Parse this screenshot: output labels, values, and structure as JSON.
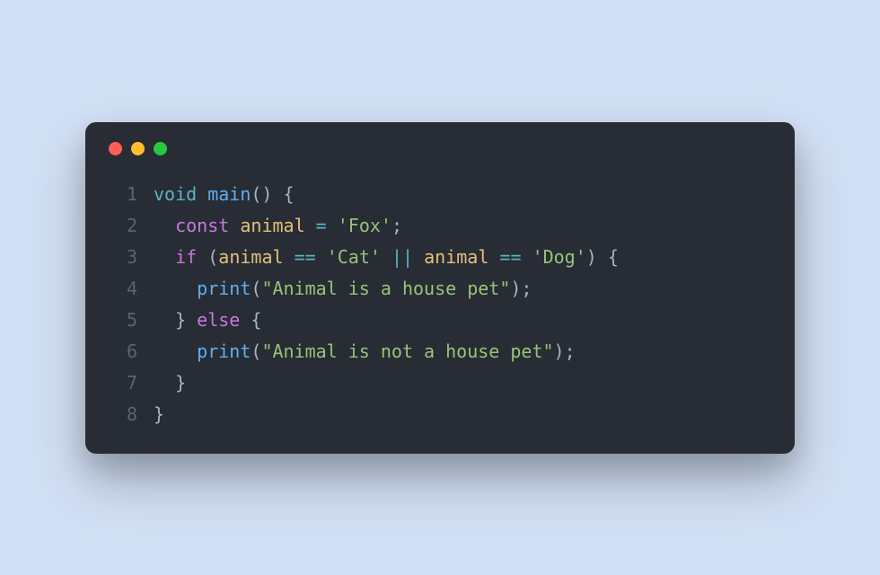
{
  "window": {
    "controls": [
      "close",
      "minimize",
      "maximize"
    ]
  },
  "code": {
    "lines": [
      {
        "num": "1",
        "tokens": [
          {
            "t": "void",
            "c": "tok-keyword1"
          },
          {
            "t": " ",
            "c": "tok-default"
          },
          {
            "t": "main",
            "c": "tok-func"
          },
          {
            "t": "() {",
            "c": "tok-punct"
          }
        ]
      },
      {
        "num": "2",
        "tokens": [
          {
            "t": "  ",
            "c": "tok-default"
          },
          {
            "t": "const",
            "c": "tok-keyword2"
          },
          {
            "t": " ",
            "c": "tok-default"
          },
          {
            "t": "animal",
            "c": "tok-ident"
          },
          {
            "t": " ",
            "c": "tok-default"
          },
          {
            "t": "=",
            "c": "tok-op"
          },
          {
            "t": " ",
            "c": "tok-default"
          },
          {
            "t": "'Fox'",
            "c": "tok-string"
          },
          {
            "t": ";",
            "c": "tok-punct"
          }
        ]
      },
      {
        "num": "3",
        "tokens": [
          {
            "t": "  ",
            "c": "tok-default"
          },
          {
            "t": "if",
            "c": "tok-keyword2"
          },
          {
            "t": " (",
            "c": "tok-punct"
          },
          {
            "t": "animal",
            "c": "tok-ident"
          },
          {
            "t": " ",
            "c": "tok-default"
          },
          {
            "t": "==",
            "c": "tok-op"
          },
          {
            "t": " ",
            "c": "tok-default"
          },
          {
            "t": "'Cat'",
            "c": "tok-string"
          },
          {
            "t": " ",
            "c": "tok-default"
          },
          {
            "t": "||",
            "c": "tok-op"
          },
          {
            "t": " ",
            "c": "tok-default"
          },
          {
            "t": "animal",
            "c": "tok-ident"
          },
          {
            "t": " ",
            "c": "tok-default"
          },
          {
            "t": "==",
            "c": "tok-op"
          },
          {
            "t": " ",
            "c": "tok-default"
          },
          {
            "t": "'Dog'",
            "c": "tok-string"
          },
          {
            "t": ") {",
            "c": "tok-punct"
          }
        ]
      },
      {
        "num": "4",
        "tokens": [
          {
            "t": "    ",
            "c": "tok-default"
          },
          {
            "t": "print",
            "c": "tok-func"
          },
          {
            "t": "(",
            "c": "tok-punct"
          },
          {
            "t": "\"Animal is a house pet\"",
            "c": "tok-string"
          },
          {
            "t": ");",
            "c": "tok-punct"
          }
        ]
      },
      {
        "num": "5",
        "tokens": [
          {
            "t": "  } ",
            "c": "tok-punct"
          },
          {
            "t": "else",
            "c": "tok-keyword2"
          },
          {
            "t": " {",
            "c": "tok-punct"
          }
        ]
      },
      {
        "num": "6",
        "tokens": [
          {
            "t": "    ",
            "c": "tok-default"
          },
          {
            "t": "print",
            "c": "tok-func"
          },
          {
            "t": "(",
            "c": "tok-punct"
          },
          {
            "t": "\"Animal is not a house pet\"",
            "c": "tok-string"
          },
          {
            "t": ");",
            "c": "tok-punct"
          }
        ]
      },
      {
        "num": "7",
        "tokens": [
          {
            "t": "  }",
            "c": "tok-punct"
          }
        ]
      },
      {
        "num": "8",
        "tokens": [
          {
            "t": "}",
            "c": "tok-punct"
          }
        ]
      }
    ]
  }
}
